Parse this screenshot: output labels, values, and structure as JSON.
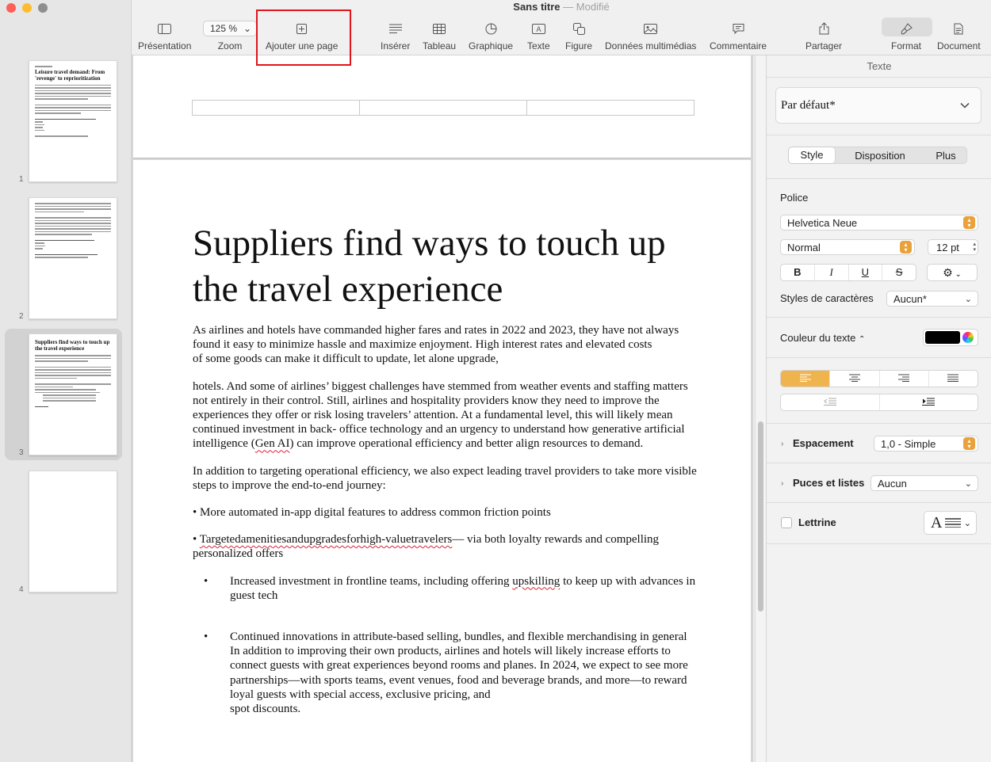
{
  "window": {
    "title": "Sans titre",
    "separator": "—",
    "status": "Modifié"
  },
  "toolbar": {
    "presentation": "Présentation",
    "zoom_value": "125 %",
    "zoom": "Zoom",
    "add_page": "Ajouter une page",
    "insert": "Insérer",
    "table": "Tableau",
    "chart": "Graphique",
    "text": "Texte",
    "shape": "Figure",
    "media": "Données multimédias",
    "comment": "Commentaire",
    "share": "Partager",
    "format": "Format",
    "document": "Document"
  },
  "sidebar": {
    "pages": [
      {
        "number": "1",
        "title": "Leisure travel demand: From 'revenge' to reprioritization"
      },
      {
        "number": "2",
        "title": ""
      },
      {
        "number": "3",
        "title": "Suppliers find ways to touch up the travel experience"
      },
      {
        "number": "4",
        "title": ""
      }
    ]
  },
  "document": {
    "heading": "Suppliers find ways to touch up the travel experience",
    "para1_line1": "As airlines and hotels have commanded higher fares and rates in 2022 and 2023, they have not always found it easy to minimize hassle and maximize enjoyment. High interest rates and elevated costs",
    "para1_line2": "of some goods can make it difficult to update, let alone upgrade,",
    "para2_a": "hotels. And some of airlines’ biggest challenges have stemmed from weather events and staffing matters not entirely in their control. Still, airlines and hospitality providers know they need to improve the experiences they offer or risk losing travelers’ attention. At a fundamental level, this will likely mean continued investment in back- office technology and an urgency to understand how generative artificial intelligence (",
    "para2_genai": "Gen AI",
    "para2_b": ") can improve operational efficiency and better align resources to demand.",
    "para3": "In addition to targeting operational efficiency, we also expect leading travel providers to take more visible steps to improve the end-to-end journey:",
    "bullet1": "• More automated in-app digital features to address common friction points",
    "bullet2_prefix": "• ",
    "bullet2_word": "Targetedamenitiesandupgradesforhigh-valuetravelers",
    "bullet2_rest": "— via both loyalty rewards and compelling personalized offers",
    "sub1_a": "Increased investment in frontline teams, including offering ",
    "sub1_word": "upskilling",
    "sub1_b": " to keep up with advances in guest tech",
    "sub2_line1": "Continued innovations in attribute-based selling, bundles, and flexible merchandising in general",
    "sub2_line2": "In addition to improving their own products, airlines and hotels will likely increase efforts to connect guests with great experiences beyond rooms and planes. In 2024, we expect to see more partnerships—with sports teams, event venues, food and beverage brands, and more—to reward loyal guests with special access, exclusive pricing, and",
    "sub2_line3": "spot discounts."
  },
  "inspector": {
    "title": "Texte",
    "paragraph_style": "Par défaut*",
    "tabs": [
      "Style",
      "Disposition",
      "Plus"
    ],
    "font_section": "Police",
    "font_family": "Helvetica Neue",
    "font_weight": "Normal",
    "font_size": "12 pt",
    "bold": "B",
    "italic": "I",
    "underline": "U",
    "strike": "S",
    "char_styles_label": "Styles de caractères",
    "char_styles_value": "Aucun*",
    "text_color_label": "Couleur du texte",
    "text_color": "#000000",
    "spacing_label": "Espacement",
    "spacing_value": "1,0 - Simple",
    "bullets_label": "Puces et listes",
    "bullets_value": "Aucun",
    "dropcap_label": "Lettrine",
    "dropcap_letter": "A"
  }
}
